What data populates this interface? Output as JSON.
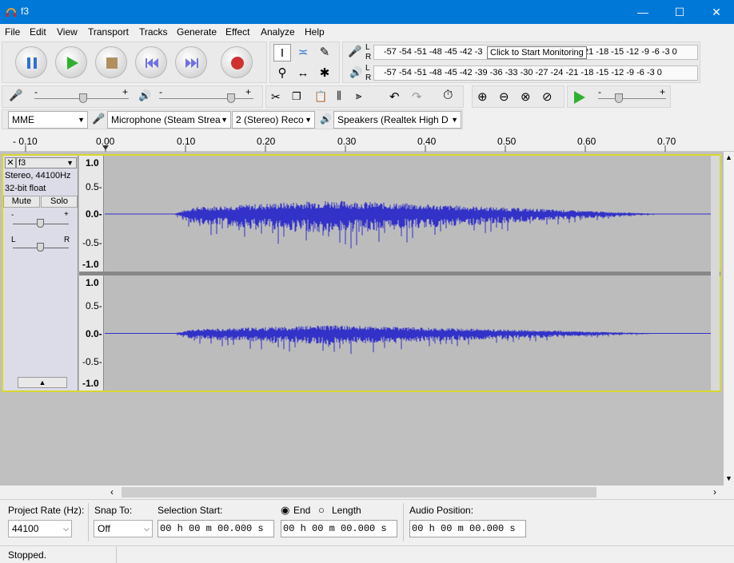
{
  "window": {
    "title": "f3",
    "minimize": "—",
    "maximize": "☐",
    "close": "✕"
  },
  "menu": [
    "File",
    "Edit",
    "View",
    "Transport",
    "Tracks",
    "Generate",
    "Effect",
    "Analyze",
    "Help"
  ],
  "meters": {
    "record_scale": "-57 -54 -51 -48 -45 -42 -3",
    "record_scale_tail": "21 -18 -15 -12  -9  -6  -3  0",
    "tooltip": "Click to Start Monitoring",
    "play_scale": "-57 -54 -51 -48 -45 -42 -39 -36 -33 -30 -27 -24 -21 -18 -15 -12  -9  -6  -3  0",
    "L": "L",
    "R": "R"
  },
  "mixer": {
    "minus": "-",
    "plus": "+"
  },
  "device": {
    "host": "MME",
    "input": "Microphone (Steam Strea",
    "channels": "2 (Stereo) Reco",
    "output": "Speakers (Realtek High D"
  },
  "ruler": {
    "ticks": [
      "- 0.10",
      "0.00",
      "0.10",
      "0.20",
      "0.30",
      "0.40",
      "0.50",
      "0.60",
      "0.70"
    ]
  },
  "track": {
    "name": "f3",
    "info1": "Stereo, 44100Hz",
    "info2": "32-bit float",
    "mute": "Mute",
    "solo": "Solo",
    "gain_minus": "-",
    "gain_plus": "+",
    "pan_left": "L",
    "pan_right": "R",
    "axis": [
      "1.0",
      "0.5-",
      "0.0-",
      "-0.5-",
      "-1.0"
    ]
  },
  "selection": {
    "project_rate_label": "Project Rate (Hz):",
    "project_rate": "44100",
    "snap_to_label": "Snap To:",
    "snap_to": "Off",
    "selection_start_label": "Selection Start:",
    "end_label": "End",
    "length_label": "Length",
    "audio_position_label": "Audio Position:",
    "time_start": "00 h 00 m 00.000 s",
    "time_end": "00 h 00 m 00.000 s",
    "time_audio": "00 h 00 m 00.000 s"
  },
  "status": "Stopped.",
  "colors": {
    "title_bar": "#0078d7",
    "waveform": "#3232c8",
    "track_selected": "#d8d830"
  }
}
